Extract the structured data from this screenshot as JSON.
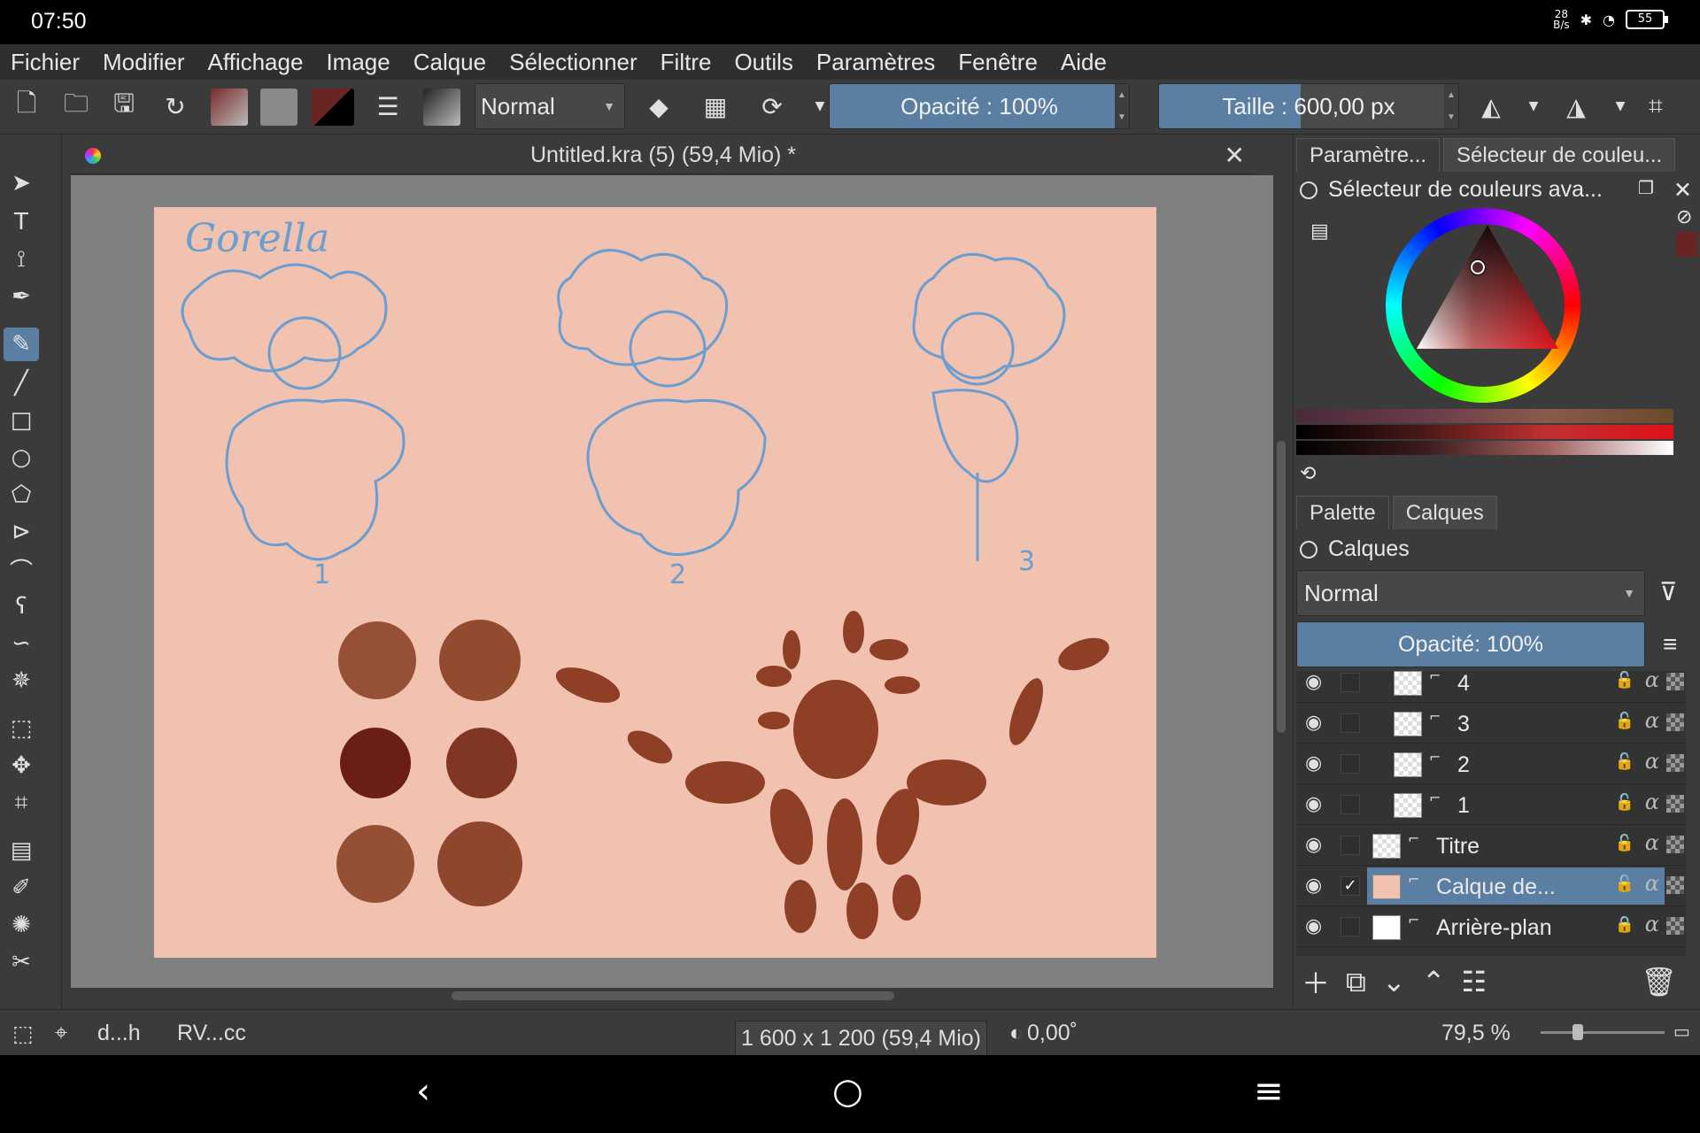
{
  "status_bar": {
    "time": "07:50",
    "net_speed_value": "28",
    "net_speed_unit": "B/s",
    "battery": "55"
  },
  "menu": [
    "Fichier",
    "Modifier",
    "Affichage",
    "Image",
    "Calque",
    "Sélectionner",
    "Filtre",
    "Outils",
    "Paramètres",
    "Fenêtre",
    "Aide"
  ],
  "toolbar": {
    "blend_mode": "Normal",
    "opacity_label": "Opacité : 100%",
    "opacity_value": 100,
    "size_label": "Taille :",
    "size_value": "600,00 px",
    "size_fill_fraction": 0.21
  },
  "document": {
    "title": "Untitled.kra (5) (59,4 Mio) *"
  },
  "canvas": {
    "sketch_title": "Gorella",
    "sketch_numbers": [
      "1",
      "2",
      "3"
    ]
  },
  "dock_tabs": [
    "Paramètre...",
    "Sélecteur de couleu..."
  ],
  "color_selector": {
    "title": "Sélecteur de couleurs ava..."
  },
  "layer_panel_tabs": [
    "Palette",
    "Calques"
  ],
  "layers_panel": {
    "title": "Calques",
    "blend_mode": "Normal",
    "opacity_label": "Opacité:  100%",
    "layers": [
      {
        "name": "4",
        "selected": false,
        "locked": false,
        "checked": false
      },
      {
        "name": "3",
        "selected": false,
        "locked": false,
        "checked": false
      },
      {
        "name": "2",
        "selected": false,
        "locked": false,
        "checked": false
      },
      {
        "name": "1",
        "selected": false,
        "locked": false,
        "checked": false
      },
      {
        "name": "Titre",
        "selected": false,
        "locked": false,
        "checked": false
      },
      {
        "name": "Calque de...",
        "selected": true,
        "locked": false,
        "checked": true
      },
      {
        "name": "Arrière-plan",
        "selected": false,
        "locked": true,
        "checked": false
      }
    ]
  },
  "bottom_status": {
    "brush": "d...h",
    "color_profile": "RV...cc",
    "canvas_size": "1 600 x 1 200 (59,4 Mio)",
    "rotation": "0,00˚",
    "zoom": "79,5 %"
  },
  "colors": {
    "accent": "#5b7fa3",
    "paper": "#f2c2b0",
    "sketch": "#6a9ed0",
    "paint_dark": "#7a2e1e",
    "paint": "#9c4a2e"
  }
}
